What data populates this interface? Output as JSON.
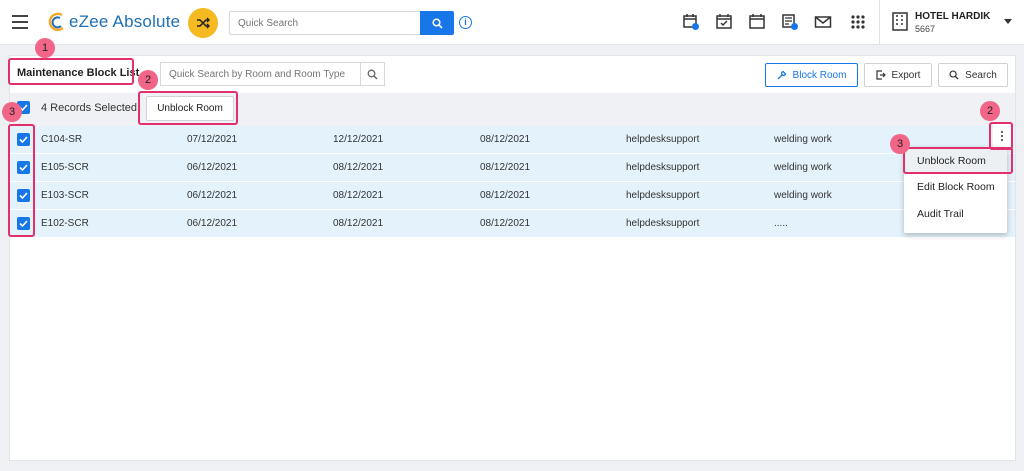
{
  "app": {
    "name": "eZee Absolute",
    "brand_color": "#1877e8",
    "accent_color": "#f5b921"
  },
  "header": {
    "search_placeholder": "Quick Search",
    "info_icon_glyph": "i",
    "icons": [
      "calendar-add-icon",
      "calendar-check-icon",
      "calendar-icon",
      "calendar-dollar-icon",
      "mail-icon",
      "apps-grid-icon"
    ],
    "hotel": {
      "name": "HOTEL HARDIK",
      "id": "5667"
    }
  },
  "toolbar": {
    "title": "Maintenance Block List",
    "room_search_placeholder": "Quick Search by Room and Room Type",
    "block_room_label": "Block Room",
    "export_label": "Export",
    "search_label": "Search"
  },
  "selection": {
    "records_selected": "4 Records Selected",
    "unblock_label": "Unblock Room"
  },
  "rows": [
    {
      "room": "C104-SR",
      "from": "07/12/2021",
      "to": "12/12/2021",
      "date": "08/12/2021",
      "user": "helpdesksupport",
      "reason": "welding work",
      "checked": true
    },
    {
      "room": "E105-SCR",
      "from": "06/12/2021",
      "to": "08/12/2021",
      "date": "08/12/2021",
      "user": "helpdesksupport",
      "reason": "welding work",
      "checked": true
    },
    {
      "room": "E103-SCR",
      "from": "06/12/2021",
      "to": "08/12/2021",
      "date": "08/12/2021",
      "user": "helpdesksupport",
      "reason": "welding work",
      "checked": true
    },
    {
      "room": "E102-SCR",
      "from": "06/12/2021",
      "to": "08/12/2021",
      "date": "08/12/2021",
      "user": "helpdesksupport",
      "reason": ".....",
      "checked": true
    }
  ],
  "context_menu": {
    "items": [
      "Unblock Room",
      "Edit Block Room",
      "Audit Trail"
    ],
    "active_index": 0
  },
  "annotations": {
    "color": "#e1306c",
    "badges": [
      "1",
      "2",
      "3",
      "2",
      "3"
    ]
  }
}
